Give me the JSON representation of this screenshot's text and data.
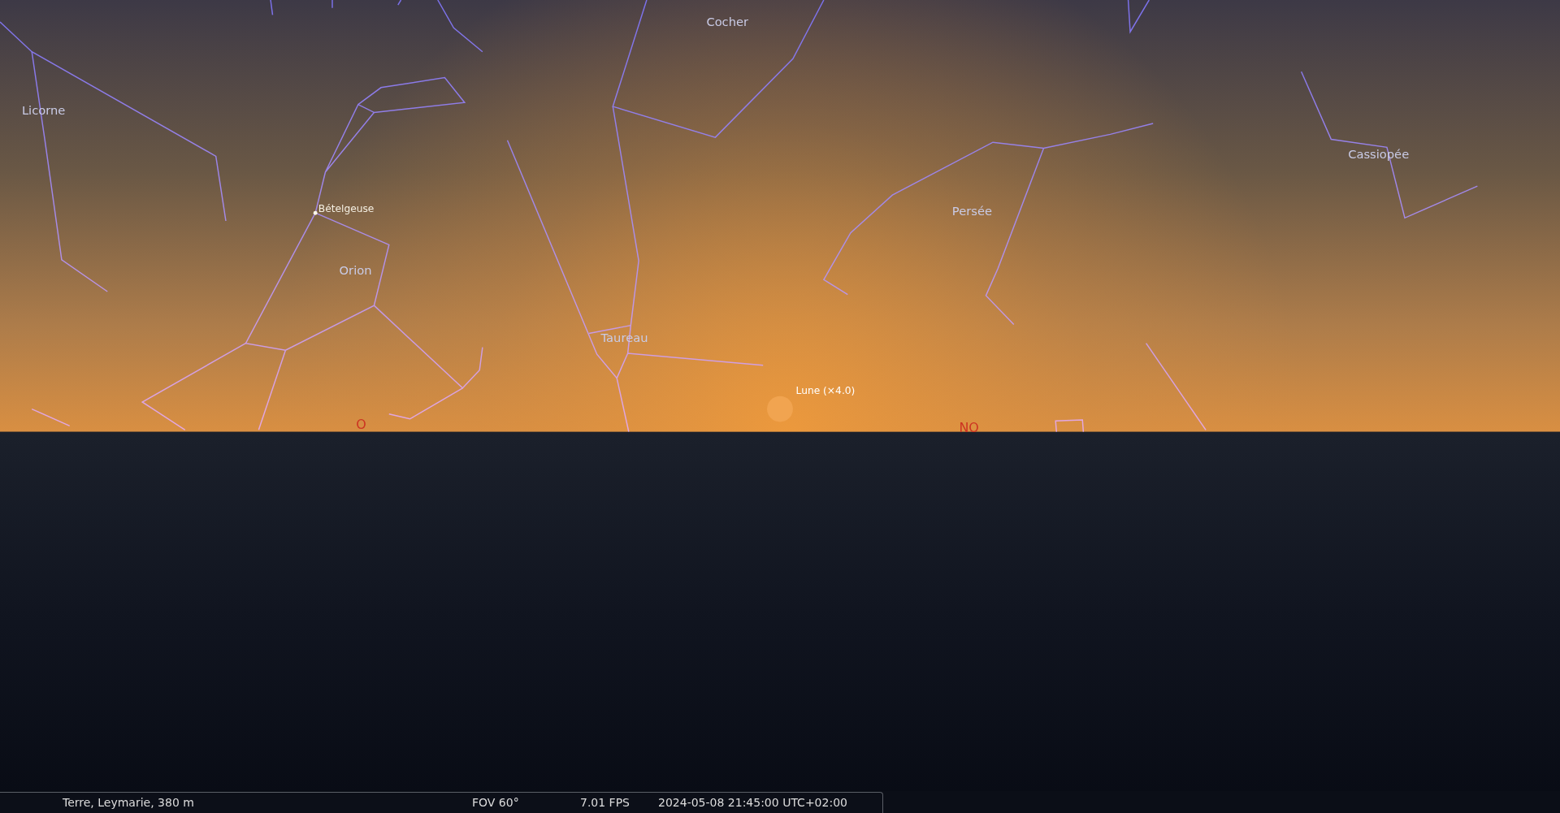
{
  "sky_labels": [
    {
      "kind": "constellation",
      "text": "Cocher"
    },
    {
      "kind": "constellation",
      "text": "Licorne"
    },
    {
      "kind": "star",
      "text": "Bételgeuse"
    },
    {
      "kind": "constellation",
      "text": "Orion"
    },
    {
      "kind": "constellation",
      "text": "Taureau"
    },
    {
      "kind": "moon",
      "text": "Lune (×4.0)"
    },
    {
      "kind": "constellation",
      "text": "Persée"
    },
    {
      "kind": "constellation",
      "text": "Cassiopée"
    },
    {
      "kind": "cardinal",
      "text": "O"
    },
    {
      "kind": "cardinal",
      "text": "NO"
    }
  ],
  "status_bar": {
    "location": "Terre, Leymarie, 380 m",
    "fov": "FOV 60°",
    "fps": "7.01 FPS",
    "datetime": "2024-05-08 21:45:00 UTC+02:00"
  }
}
